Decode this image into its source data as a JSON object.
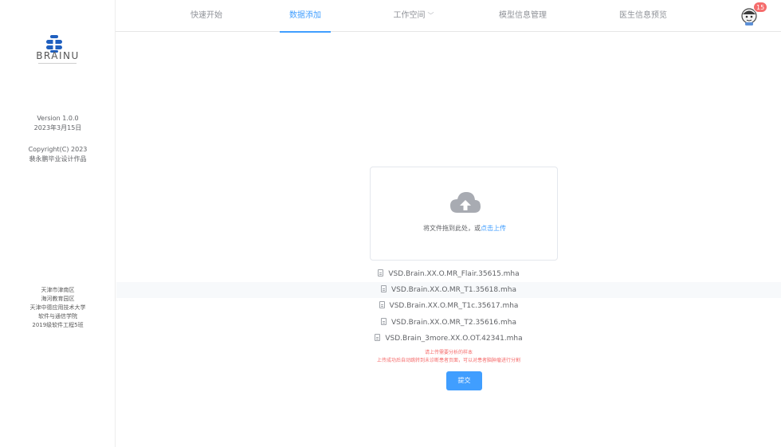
{
  "nav": {
    "items": [
      {
        "label": "快速开始"
      },
      {
        "label": "数据添加"
      },
      {
        "label": "工作空间"
      },
      {
        "label": "模型信息管理"
      },
      {
        "label": "医生信息预览"
      }
    ],
    "active_index": 1,
    "notification_count": "15"
  },
  "sidebar": {
    "brand": "BRAINU",
    "version": "Version 1.0.0",
    "date": "2023年3月15日",
    "copyright": "Copyright(C) 2023",
    "author": "裴永鹏毕业设计作品",
    "address": [
      "天津市津南区",
      "海河教育园区",
      "天津中德应用技术大学",
      "软件与通信学院",
      "2019级软件工程5班"
    ]
  },
  "upload": {
    "text": "将文件拖到此处，或",
    "link": "点击上传"
  },
  "files": [
    "VSD.Brain.XX.O.MR_Flair.35615.mha",
    "VSD.Brain.XX.O.MR_T1.35618.mha",
    "VSD.Brain.XX.O.MR_T1c.35617.mha",
    "VSD.Brain.XX.O.MR_T2.35616.mha",
    "VSD.Brain_3more.XX.O.OT.42341.mha"
  ],
  "tips": {
    "line1": "请上传需要分析的样本",
    "line2": "上传成功后自动跳转到未诊断患者页面，可以对患者脑肿瘤进行分割"
  },
  "submit_label": "提交",
  "colors": {
    "accent": "#409eff",
    "danger": "#f56c6c"
  }
}
